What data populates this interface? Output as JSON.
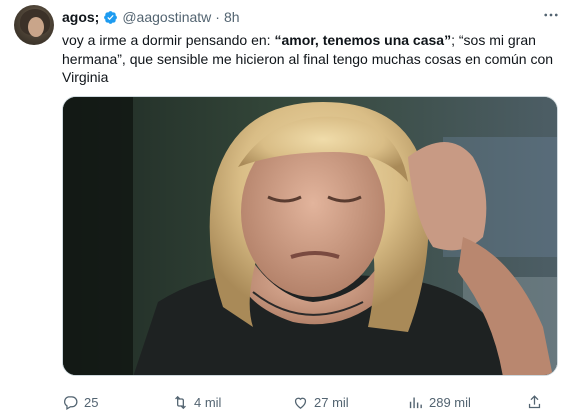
{
  "author": {
    "name": "agos;",
    "handle": "@aagostinatw",
    "separator": "·",
    "time": "8h"
  },
  "tweet": {
    "text_part1": "voy a irme a dormir pensando en: ",
    "text_bold1": "“amor, tenemos una casa”",
    "text_part2": "; “sos mi gran hermana”, que sensible me hicieron al final tengo muchas cosas en común con Virginia"
  },
  "actions": {
    "replies": "25",
    "retweets": "4 mil",
    "likes": "27 mil",
    "views": "289 mil"
  },
  "icons": {
    "verified": "verified-badge-icon",
    "more": "more-options-icon",
    "reply": "reply-icon",
    "retweet": "retweet-icon",
    "like": "heart-icon",
    "views": "views-bar-chart-icon",
    "share": "share-icon"
  },
  "colors": {
    "verified_blue": "#1d9bf0",
    "muted": "#536471",
    "text": "#0f1419"
  }
}
